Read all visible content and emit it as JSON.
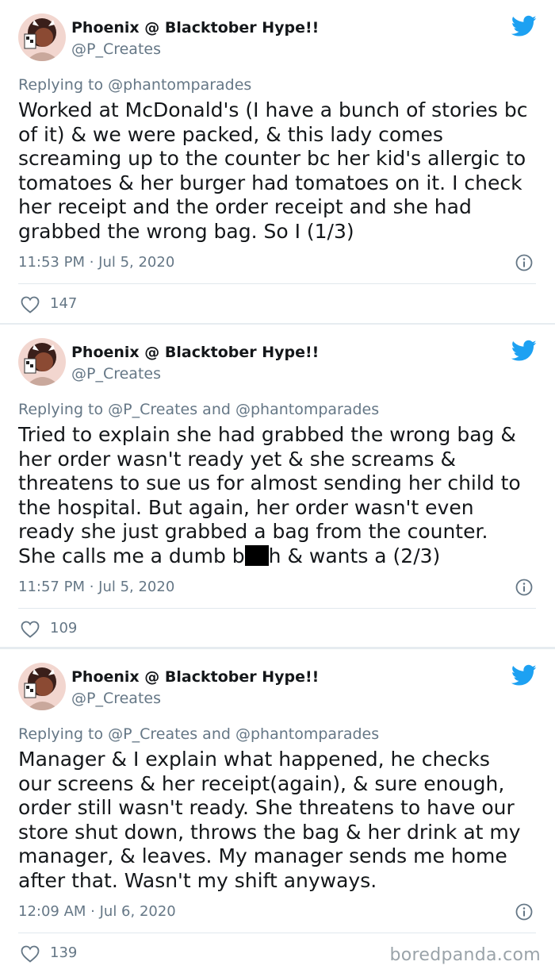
{
  "colors": {
    "twitter_blue": "#1da1f2",
    "secondary_text": "#657786",
    "primary_text": "#14171a",
    "background": "#e6ecf0"
  },
  "tweets": [
    {
      "display_name": "Phoenix @ Blacktober Hype!!",
      "handle": "@P_Creates",
      "reply_prefix": "Replying to ",
      "reply_mentions": "@phantomparades",
      "text": "Worked at McDonald's (I have a bunch of stories bc\nof it) & we were packed, & this lady comes\nscreaming up to the counter bc her kid's allergic to\ntomatoes & her burger had tomatoes on it. I check\nher receipt and the order receipt and she had\ngrabbed the wrong bag. So I (1/3)",
      "timestamp": "11:53 PM · Jul 5, 2020",
      "likes": "147",
      "icons": [
        "avatar",
        "twitter-bird-icon",
        "info-icon",
        "heart-icon"
      ]
    },
    {
      "display_name": "Phoenix @ Blacktober Hype!!",
      "handle": "@P_Creates",
      "reply_prefix": "Replying to ",
      "reply_mentions": "@P_Creates and @phantomparades",
      "text_before_redaction": "Tried to explain she had grabbed the wrong bag &\nher order wasn't ready yet & she screams &\nthreatens to sue us for almost sending her child to\nthe hospital. But again, her order wasn't even\nready she just grabbed a bag from the counter.\nShe calls me a dumb b",
      "text_after_redaction": "h & wants a (2/3)",
      "timestamp": "11:57 PM · Jul 5, 2020",
      "likes": "109",
      "icons": [
        "avatar",
        "twitter-bird-icon",
        "info-icon",
        "heart-icon"
      ]
    },
    {
      "display_name": "Phoenix @ Blacktober Hype!!",
      "handle": "@P_Creates",
      "reply_prefix": "Replying to ",
      "reply_mentions": "@P_Creates and @phantomparades",
      "text": "Manager & I explain what happened, he checks\nour screens & her receipt(again), & sure enough,\norder still wasn't ready. She threatens to have our\nstore shut down, throws the bag & her drink at my\nmanager, & leaves. My manager sends me home\nafter that. Wasn't my shift anyways.",
      "timestamp": "12:09 AM · Jul 6, 2020",
      "likes": "139",
      "icons": [
        "avatar",
        "twitter-bird-icon",
        "info-icon",
        "heart-icon"
      ]
    }
  ],
  "watermark": "boredpanda.com"
}
